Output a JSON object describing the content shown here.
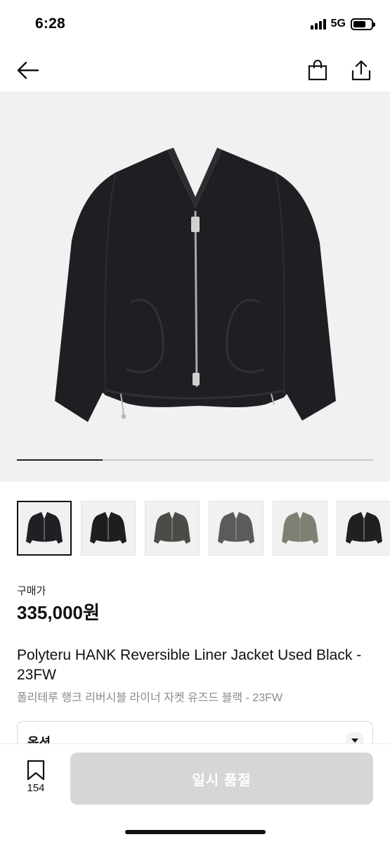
{
  "status": {
    "time": "6:28",
    "network": "5G",
    "battery_level": 0.72
  },
  "nav": {
    "back_icon": "arrow-left-icon",
    "bag_icon": "shopping-bag-icon",
    "share_icon": "share-icon"
  },
  "gallery": {
    "progress": 0.24,
    "thumbnails": [
      {
        "color": "#1e2023",
        "selected": true
      },
      {
        "color": "#1c1e20",
        "selected": false
      },
      {
        "color": "#4a4c47",
        "selected": false
      },
      {
        "color": "#5b5c5a",
        "selected": false
      },
      {
        "color": "#7d8173",
        "selected": false
      },
      {
        "color": "#1f2022",
        "selected": false
      }
    ]
  },
  "product": {
    "price_label": "구매가",
    "price": "335,000원",
    "title_en": "Polyteru HANK Reversible Liner Jacket Used Black - 23FW",
    "title_ko": "폴리테루 행크 리버시블 라이너 자켓 유즈드 블랙 - 23FW"
  },
  "option": {
    "label": "옵션",
    "icon": "chevron-down-icon"
  },
  "bottom": {
    "bookmark_icon": "bookmark-icon",
    "bookmark_count": "154",
    "cta_label": "일시 품절"
  },
  "colors": {
    "jacket": "#1d1f22",
    "hero_bg": "#f1f1f1",
    "cta_disabled": "#d6d6d6"
  }
}
